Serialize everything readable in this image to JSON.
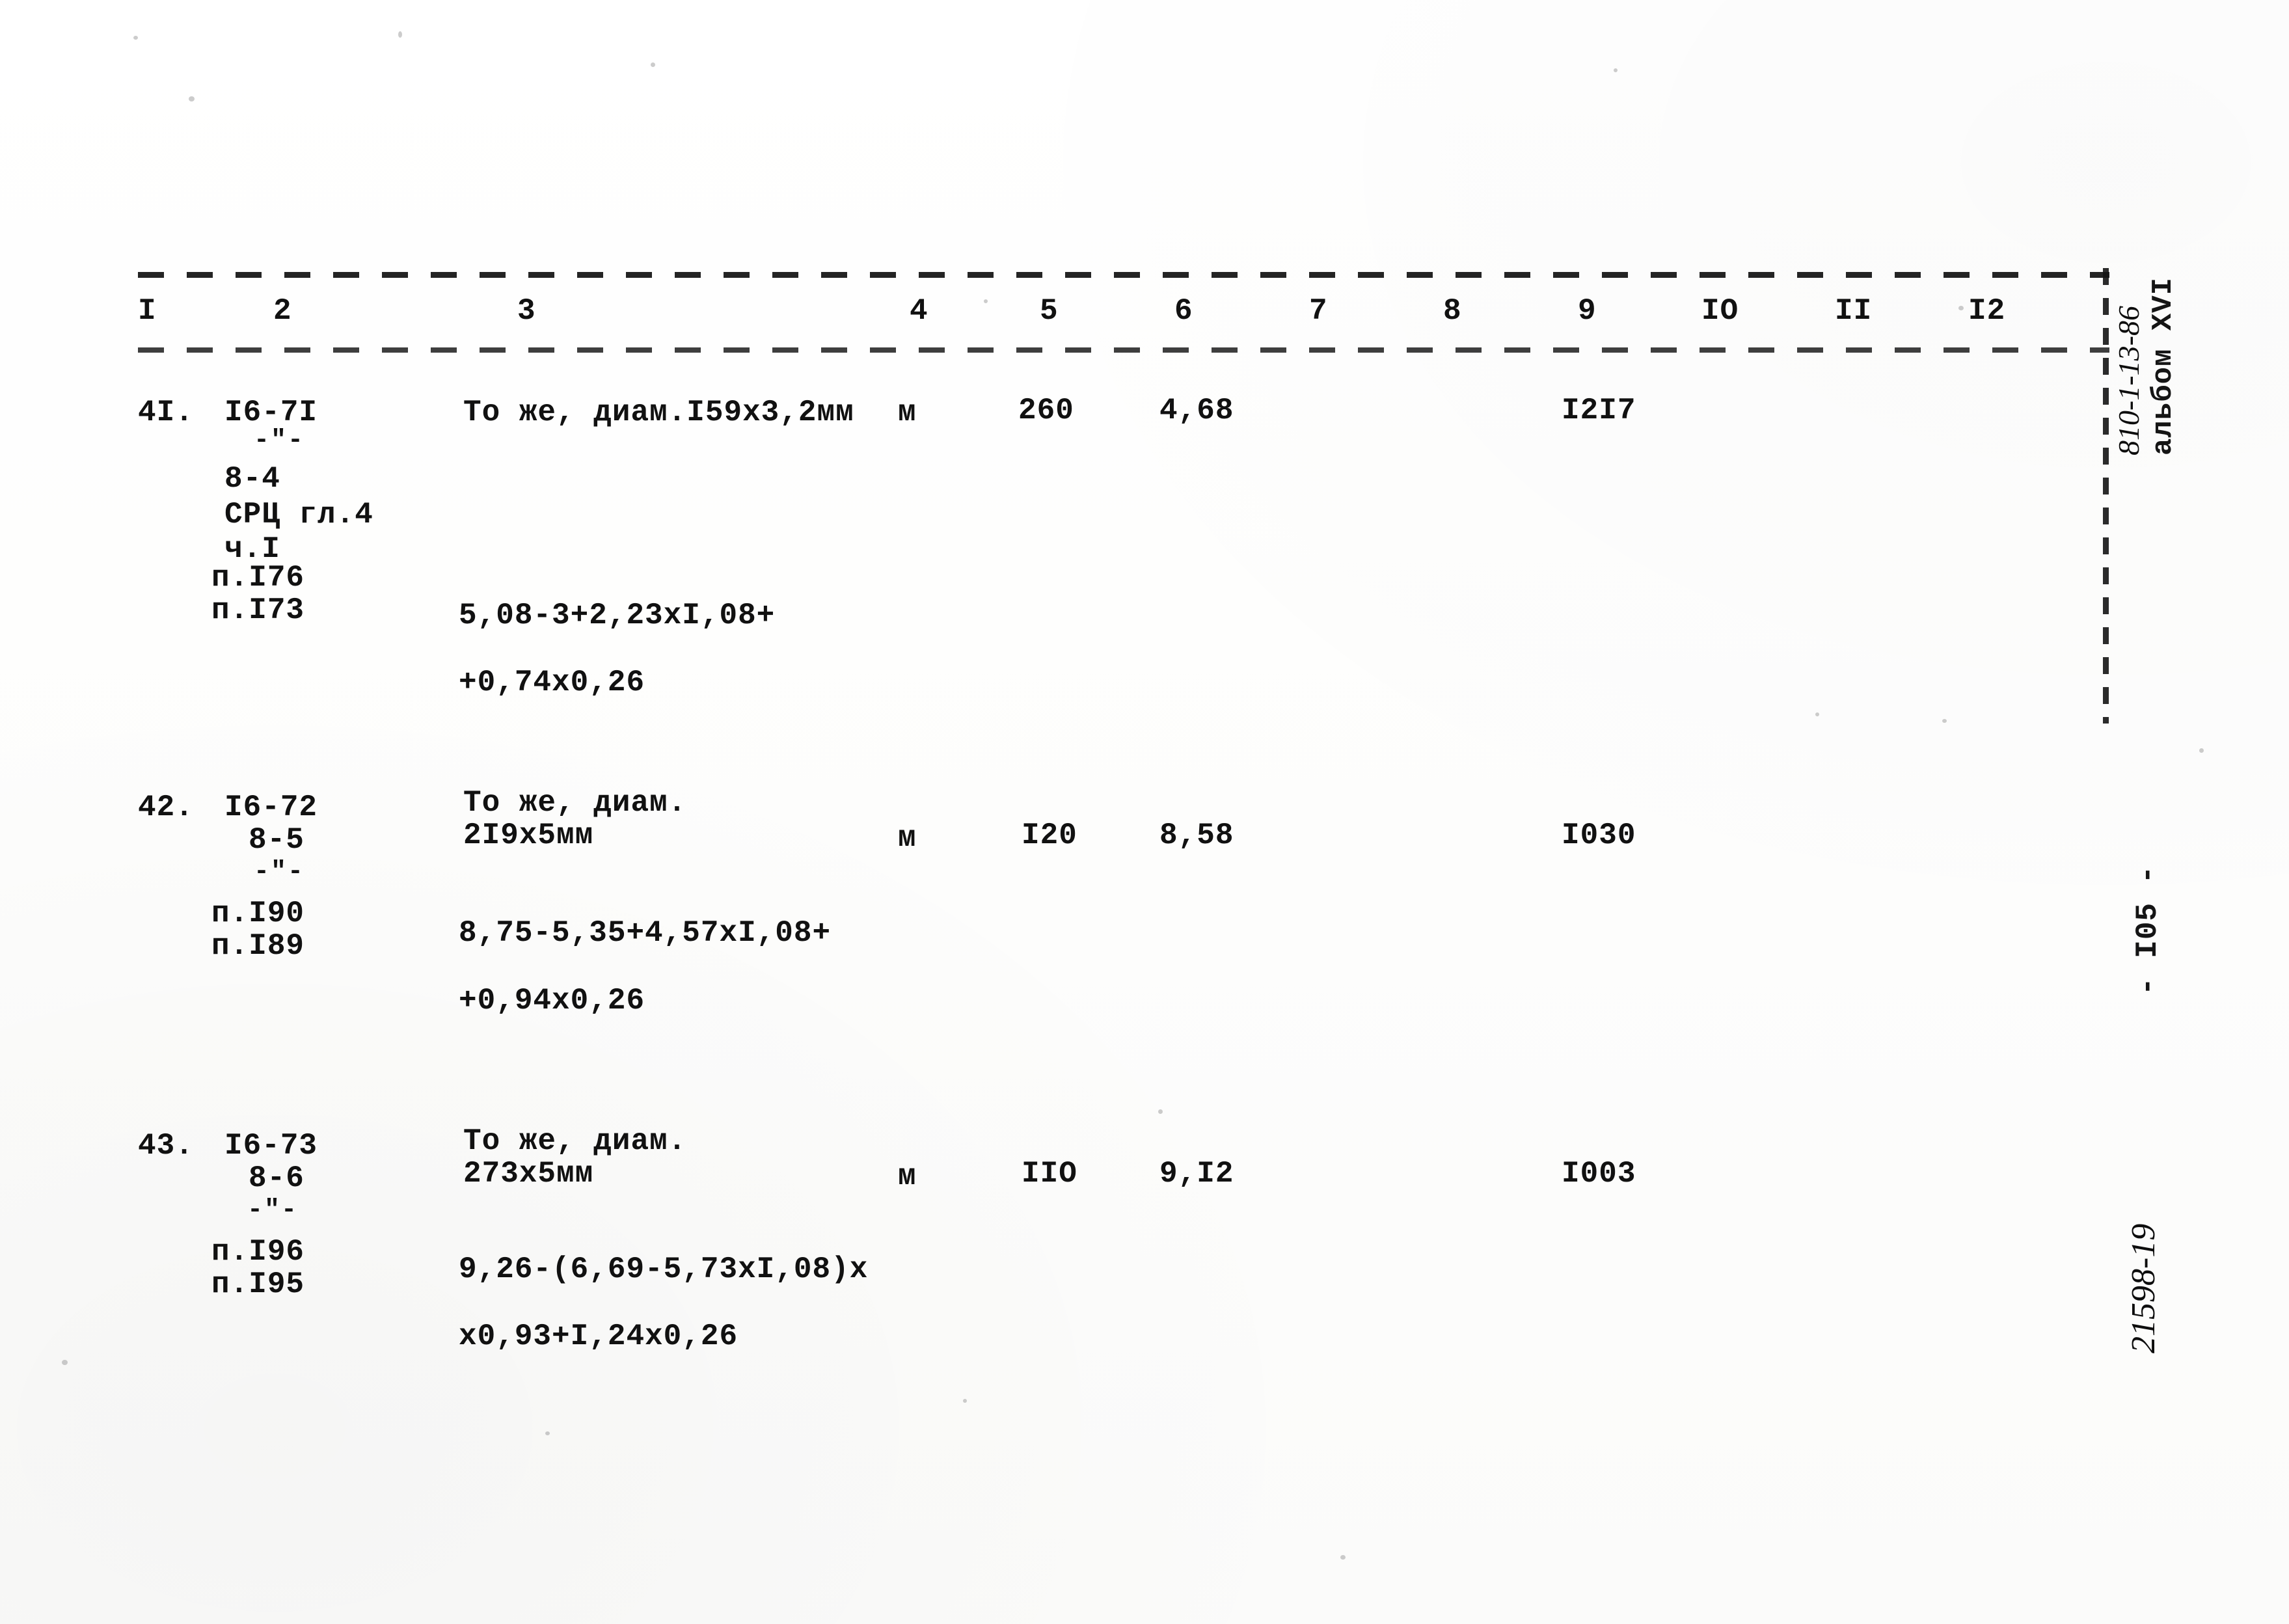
{
  "document": {
    "type": "typewritten-estimate-table",
    "page_number": "- I05 -",
    "album_label": "альбом XVI",
    "album_code_handwritten": "810-1-13-86",
    "archive_number_handwritten": "21598-19"
  },
  "table": {
    "column_headers": [
      "I",
      "2",
      "3",
      "4",
      "5",
      "6",
      "7",
      "8",
      "9",
      "IO",
      "II",
      "I2"
    ],
    "rows": [
      {
        "number": "4I.",
        "code_lines": [
          "I6-7I",
          "-\"-",
          "8-4",
          "СРЦ гл.4",
          "ч.I",
          "п.I76",
          "п.I73"
        ],
        "description": "То же, диам.I59х3,2мм",
        "unit": "м",
        "quantity": "260",
        "price": "4,68",
        "col7": "",
        "col8": "",
        "col9": "I2I7",
        "col10": "",
        "col11": "",
        "col12": "",
        "formula_lines": [
          "5,08-3+2,23xI,08+",
          "+0,74x0,26"
        ]
      },
      {
        "number": "42.",
        "code_lines": [
          "I6-72",
          "8-5",
          "-\"-",
          "п.I90",
          "п.I89"
        ],
        "description_lines": [
          "То же, диам.",
          "2I9х5мм"
        ],
        "unit": "м",
        "quantity": "I20",
        "price": "8,58",
        "col7": "",
        "col8": "",
        "col9": "I030",
        "col10": "",
        "col11": "",
        "col12": "",
        "formula_lines": [
          "8,75-5,35+4,57xI,08+",
          "+0,94x0,26"
        ]
      },
      {
        "number": "43.",
        "code_lines": [
          "I6-73",
          "8-6",
          "-\"-",
          "п.I96",
          "п.I95"
        ],
        "description_lines": [
          "То же, диам.",
          "273х5мм"
        ],
        "unit": "м",
        "quantity": "IIO",
        "price": "9,I2",
        "col7": "",
        "col8": "",
        "col9": "I003",
        "col10": "",
        "col11": "",
        "col12": "",
        "formula_lines": [
          "9,26-(6,69-5,73xI,08)x",
          "x0,93+I,24x0,26"
        ]
      }
    ]
  }
}
